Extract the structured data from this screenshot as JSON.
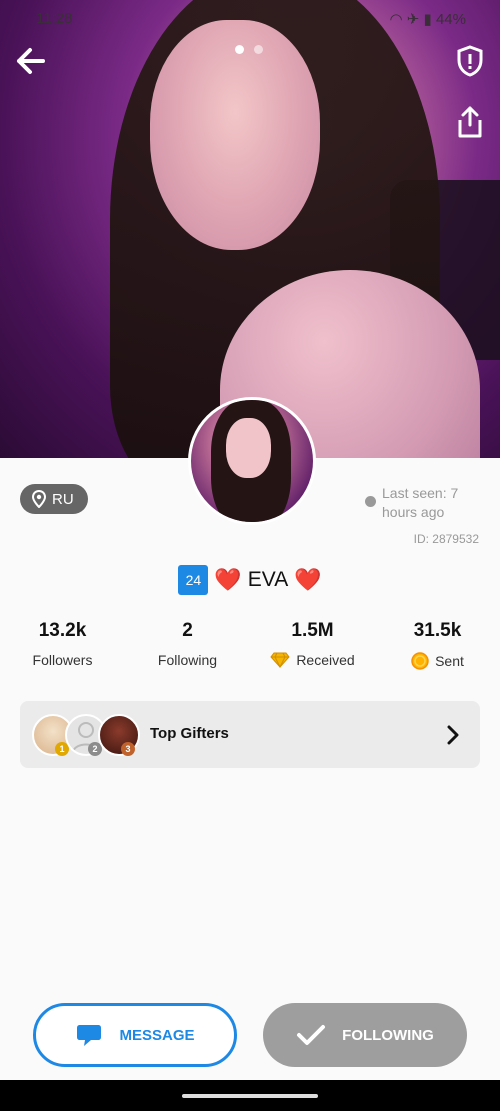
{
  "status_bar": {
    "time": "11:28",
    "battery": "44%"
  },
  "profile": {
    "location": "RU",
    "last_seen": "Last seen: 7 hours ago",
    "id_label": "ID: 2879532",
    "level": "24",
    "name": "EVA",
    "name_heart_left": "❤️",
    "name_heart_right": "❤️"
  },
  "stats": [
    {
      "value": "13.2k",
      "label": "Followers"
    },
    {
      "value": "2",
      "label": "Following"
    },
    {
      "value": "1.5M",
      "label": "Received"
    },
    {
      "value": "31.5k",
      "label": "Sent"
    }
  ],
  "top_gifters": {
    "title": "Top Gifters",
    "ranks": [
      "1",
      "2",
      "3"
    ]
  },
  "actions": {
    "message": "MESSAGE",
    "following": "FOLLOWING"
  },
  "colors": {
    "accent": "#1e88e5",
    "following_bg": "#9e9e9e",
    "diamond": "#f5b400",
    "coin": "#ffb300"
  },
  "photo_pager": {
    "count": 2,
    "active": 1
  }
}
